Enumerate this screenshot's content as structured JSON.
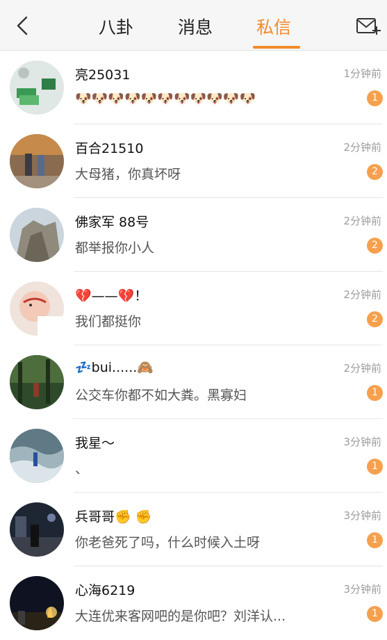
{
  "header": {
    "tabs": [
      "八卦",
      "消息",
      "私信"
    ],
    "active_tab": "私信"
  },
  "messages": [
    {
      "name": "亮25031",
      "preview": "🐶🐶🐶🐶🐶🐶🐶🐶🐶🐶🐶",
      "time": "1分钟前",
      "unread": "1"
    },
    {
      "name": "百合21510",
      "preview": "大母猪，你真坏呀",
      "time": "2分钟前",
      "unread": "2"
    },
    {
      "name": "佛家军  88号",
      "preview": "都举报你小人",
      "time": "2分钟前",
      "unread": "2"
    },
    {
      "name": "💔——💔！",
      "preview": "我们都挺你",
      "time": "2分钟前",
      "unread": "2"
    },
    {
      "name": "💤bui......🙈",
      "preview": "公交车你都不如大粪。黑寡妇",
      "time": "2分钟前",
      "unread": "1"
    },
    {
      "name": "我星～",
      "preview": "、",
      "time": "3分钟前",
      "unread": "1"
    },
    {
      "name": "兵哥哥✊ ✊",
      "preview": "你老爸死了吗，什么时候入土呀",
      "time": "3分钟前",
      "unread": "1"
    },
    {
      "name": "心海6219",
      "preview": "大连优来客网吧的是你吧？刘洋认...",
      "time": "3分钟前",
      "unread": "1"
    }
  ],
  "colors": {
    "accent": "#f28b2e",
    "badge": "#f6a04d"
  }
}
